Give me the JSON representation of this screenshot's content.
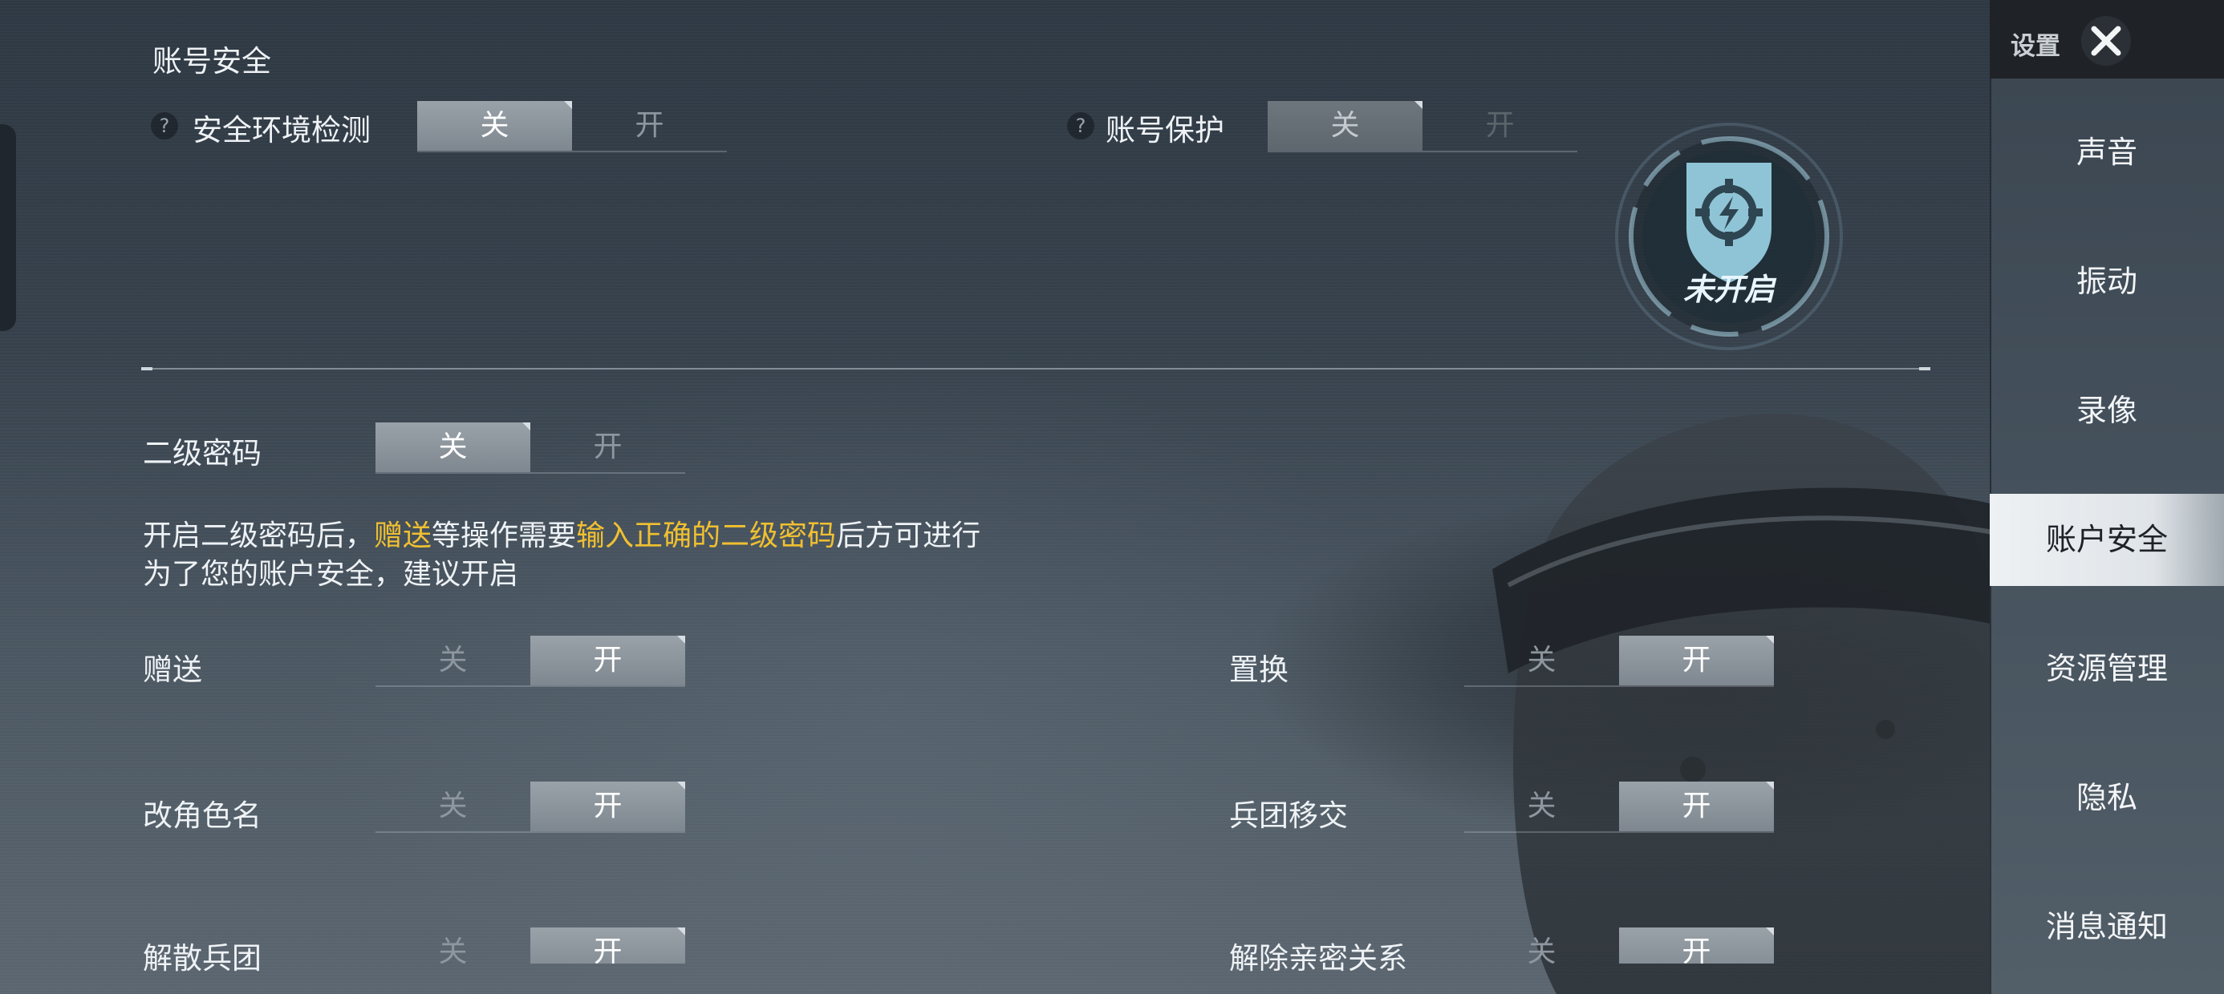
{
  "section": {
    "title": "账号安全"
  },
  "toggle_off": "关",
  "toggle_on": "开",
  "help_glyph": "?",
  "top_rows": [
    {
      "label": "安全环境检测",
      "state": "off"
    },
    {
      "label": "账号保护",
      "state": "off"
    }
  ],
  "badge": {
    "status_text": "未开启",
    "icon": "shield-lightning-icon"
  },
  "second_password": {
    "label": "二级密码",
    "state": "off"
  },
  "description": {
    "line1_part1": "开启二级密码后，",
    "line1_hl1": "赠送",
    "line1_part2": "等操作需要",
    "line1_hl2": "输入正确的二级密码",
    "line1_part3": "后方可进行",
    "line2": "为了您的账户安全，建议开启",
    "highlight_color": "#f0c030"
  },
  "operations": [
    {
      "label": "赠送",
      "state": "on"
    },
    {
      "label": "置换",
      "state": "on"
    },
    {
      "label": "改角色名",
      "state": "on"
    },
    {
      "label": "兵团移交",
      "state": "on"
    },
    {
      "label": "解散兵团",
      "state": "on"
    },
    {
      "label": "解除亲密关系",
      "state": "on"
    }
  ],
  "sidebar": {
    "title": "设置",
    "close_icon": "close-x-icon",
    "items": [
      {
        "label": "声音",
        "active": false
      },
      {
        "label": "振动",
        "active": false
      },
      {
        "label": "录像",
        "active": false
      },
      {
        "label": "账户安全",
        "active": true
      },
      {
        "label": "资源管理",
        "active": false
      },
      {
        "label": "隐私",
        "active": false
      },
      {
        "label": "消息通知",
        "active": false
      }
    ]
  }
}
